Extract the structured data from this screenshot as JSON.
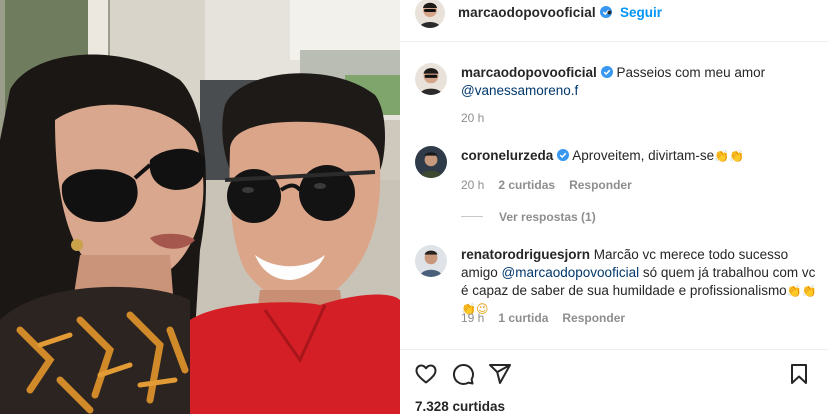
{
  "header": {
    "username": "marcaodopovooficial",
    "separator": "•",
    "follow_label": "Seguir"
  },
  "caption": {
    "username": "marcaodopovooficial",
    "text": "Passeios com meu amor",
    "mention": "@vanessamoreno.f",
    "time": "20 h"
  },
  "comments": [
    {
      "username": "coronelurzeda",
      "text": "Aproveitem, divirtam-se",
      "emoji": "👏👏",
      "time": "20 h",
      "likes": "2 curtidas",
      "reply": "Responder",
      "view_replies": "Ver respostas (1)"
    },
    {
      "username": "renatorodriguesjorn",
      "text_start": "Marcão vc merece todo sucesso amigo",
      "mention": "@marcaodopovooficial",
      "text_end": "só quem já trabalhou com vc é capaz de saber de sua humildade e profissionalismo",
      "emoji": "👏👏👏😉",
      "time": "19 h",
      "likes": "1 curtida",
      "reply": "Responder"
    }
  ],
  "footer": {
    "likes": "7.328 curtidas"
  },
  "icons": {
    "like": "heart-icon",
    "comment": "comment-icon",
    "share": "send-icon",
    "save": "bookmark-icon"
  },
  "colors": {
    "link": "#0095f6",
    "mention": "#00376b",
    "secondary": "#8e8e8e",
    "verified": "#3897f0"
  }
}
